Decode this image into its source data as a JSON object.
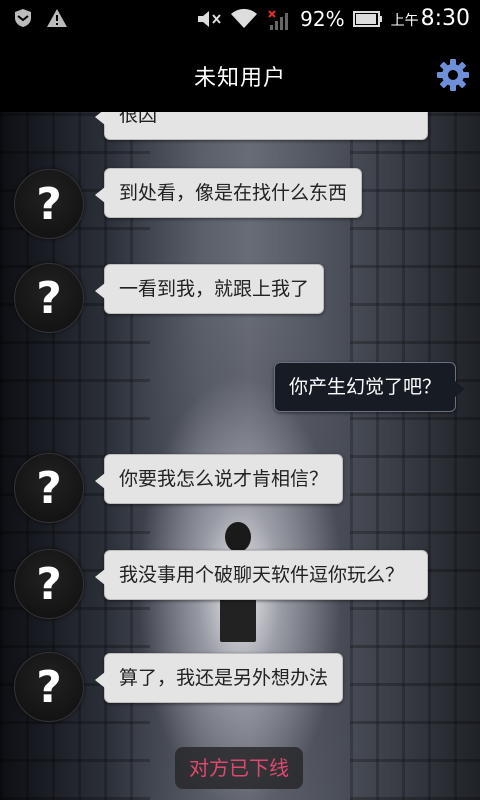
{
  "status_bar": {
    "icons_left": [
      "shield-icon",
      "warning-icon"
    ],
    "icons_right": [
      "mute-icon",
      "wifi-icon",
      "signal-icon",
      "battery-icon"
    ],
    "battery": "92%",
    "ampm": "上午",
    "time": "8:30"
  },
  "header": {
    "title": "未知用户",
    "settings_icon": "gear-icon",
    "accent": "#6f8fd8"
  },
  "messages": [
    {
      "side": "in",
      "text": "很囚"
    },
    {
      "side": "in",
      "text": "到处看，像是在找什么东西"
    },
    {
      "side": "in",
      "text": "一看到我，就跟上我了"
    },
    {
      "side": "out",
      "text": "你产生幻觉了吧？"
    },
    {
      "side": "in",
      "text": "你要我怎么说才肯相信？"
    },
    {
      "side": "in",
      "text": "我没事用个破聊天软件逗你玩么？"
    },
    {
      "side": "in",
      "text": "算了，我还是另外想办法"
    }
  ],
  "avatar_glyph": "?",
  "status_notice": "对方已下线",
  "colors": {
    "notice": "#e0486e",
    "in_bubble": "#e4e4e4",
    "out_bubble": "#161b24"
  }
}
